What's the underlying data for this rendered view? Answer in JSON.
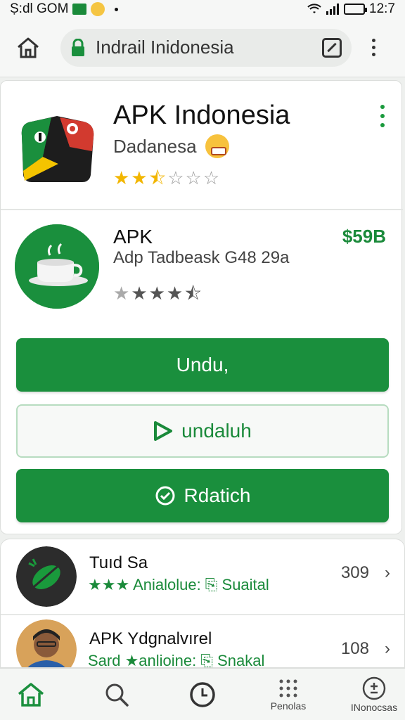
{
  "status_bar": {
    "left_text": "Ṣ:dl GOM",
    "time": "12:7"
  },
  "browser": {
    "url": "Indrail Inidonesia",
    "icons": [
      "home-icon",
      "lock-icon",
      "tab-switch-icon",
      "more-vert-icon"
    ]
  },
  "featured_app": {
    "title": "APK Indonesia",
    "subtitle": "Dadanesa",
    "rating_stars": 2.5,
    "stars_display": "★★",
    "stars_half": "⯪",
    "stars_empty": "☆☆☆"
  },
  "secondary_app": {
    "title": "APK",
    "subtitle": "Adp  Tadbeask G48 29a",
    "price": "$59B",
    "rating_stars": 3.5,
    "stars_first": "★",
    "stars_on": "★★★",
    "stars_half": "⯪"
  },
  "buttons": {
    "primary": "Undu,",
    "outline": "undaluh",
    "secondary": "Rdatich"
  },
  "list": [
    {
      "title": "Tuıd Sa",
      "meta": "★★★ Anialolue: ⎘ Suaital",
      "count": "309",
      "chevron": "›"
    },
    {
      "title": "APK Ydgnalvırel",
      "meta": "Sard ★anlioine: ⎘ Snakal",
      "count": "108",
      "chevron": "›"
    }
  ],
  "bottom_nav": [
    {
      "icon": "home-icon",
      "label": ""
    },
    {
      "icon": "search-icon",
      "label": ""
    },
    {
      "icon": "clock-icon",
      "label": ""
    },
    {
      "icon": "grid-icon",
      "label": "Penolas"
    },
    {
      "icon": "plus-minus-icon",
      "label": "INonocsas"
    }
  ],
  "colors": {
    "accent": "#1a8f3d",
    "star": "#f2b600",
    "background": "#eef0ee"
  }
}
